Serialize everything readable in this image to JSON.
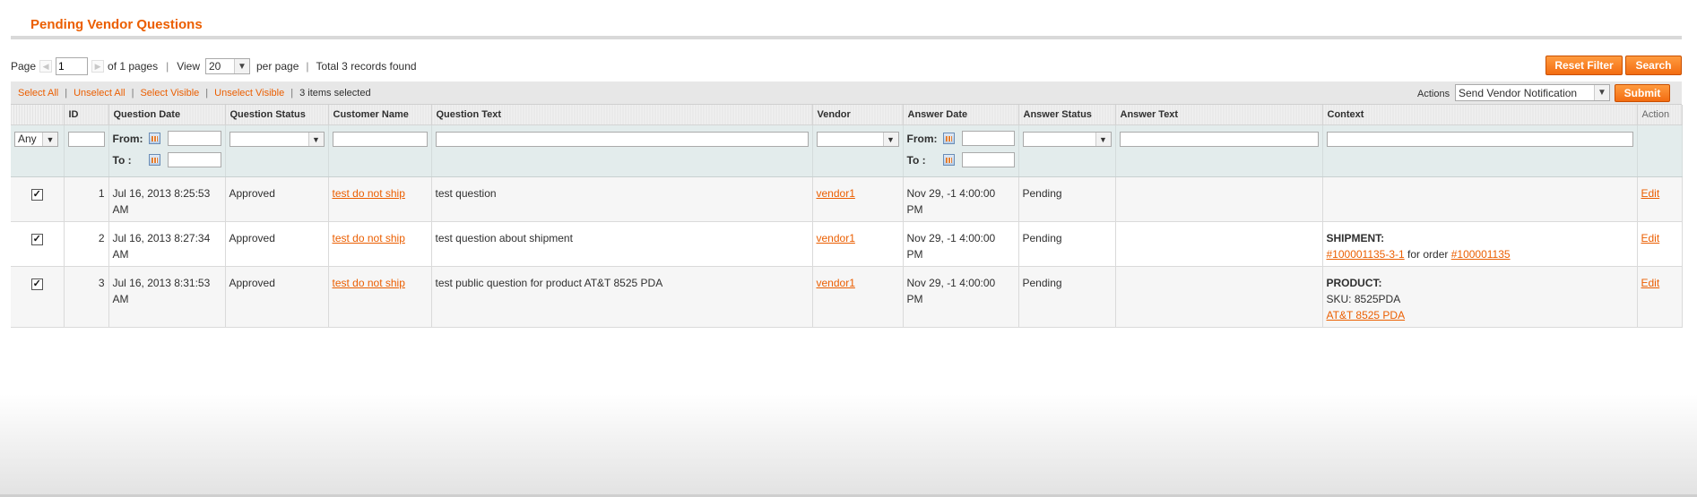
{
  "page": {
    "title": "Pending Vendor Questions"
  },
  "pager": {
    "page_label": "Page",
    "page_value": "1",
    "of_pages": "of 1 pages",
    "view_label": "View",
    "per_page_value": "20",
    "per_page_label": "per page",
    "total": "Total 3 records found"
  },
  "buttons": {
    "reset_filter": "Reset Filter",
    "search": "Search",
    "submit": "Submit"
  },
  "massaction": {
    "select_all": "Select All",
    "unselect_all": "Unselect All",
    "select_visible": "Select Visible",
    "unselect_visible": "Unselect Visible",
    "selected_count": "3 items selected",
    "actions_label": "Actions",
    "action_value": "Send Vendor Notification"
  },
  "columns": [
    "",
    "ID",
    "Question Date",
    "Question Status",
    "Customer Name",
    "Question Text",
    "Vendor",
    "Answer Date",
    "Answer Status",
    "Answer Text",
    "Context",
    "Action"
  ],
  "filters": {
    "any": "Any",
    "from": "From:",
    "to": "To :"
  },
  "rows": [
    {
      "checked": true,
      "id": "1",
      "question_date": "Jul 16, 2013 8:25:53 AM",
      "question_status": "Approved",
      "customer_name": "test do not ship",
      "question_text": "test question",
      "vendor": "vendor1",
      "answer_date": "Nov 29, -1 4:00:00 PM",
      "answer_status": "Pending",
      "answer_text": "",
      "context": {
        "title": "",
        "line1": "",
        "line1_pre": "",
        "link1": "",
        "mid": "",
        "link2": ""
      },
      "action": "Edit"
    },
    {
      "checked": true,
      "id": "2",
      "question_date": "Jul 16, 2013 8:27:34 AM",
      "question_status": "Approved",
      "customer_name": "test do not ship",
      "question_text": "test question about shipment",
      "vendor": "vendor1",
      "answer_date": "Nov 29, -1 4:00:00 PM",
      "answer_status": "Pending",
      "answer_text": "",
      "context": {
        "title": "SHIPMENT:",
        "link1": "#100001135-3-1",
        "mid": " for order ",
        "link2": "#100001135"
      },
      "action": "Edit"
    },
    {
      "checked": true,
      "id": "3",
      "question_date": "Jul 16, 2013 8:31:53 AM",
      "question_status": "Approved",
      "customer_name": "test do not ship",
      "question_text": "test public question for product AT&T 8525 PDA",
      "vendor": "vendor1",
      "answer_date": "Nov 29, -1 4:00:00 PM",
      "answer_status": "Pending",
      "answer_text": "",
      "context": {
        "title": "PRODUCT:",
        "sku": "SKU: 8525PDA",
        "link1": "AT&T 8525 PDA"
      },
      "action": "Edit"
    }
  ],
  "colors": {
    "accent": "#eb5e00",
    "filter_bg": "#e3ecec",
    "button": "#f36c11"
  }
}
